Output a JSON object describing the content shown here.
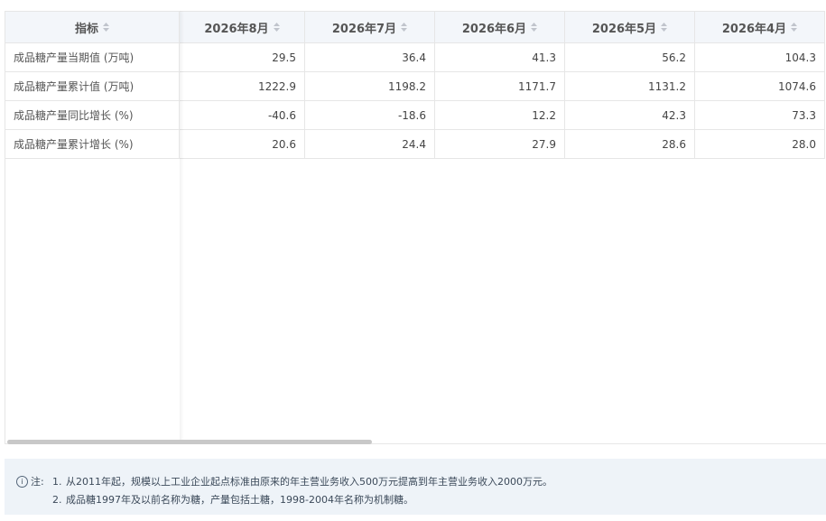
{
  "table": {
    "index_header": "指标",
    "columns": [
      "2026年8月",
      "2026年7月",
      "2026年6月",
      "2026年5月",
      "2026年4月"
    ],
    "rows": [
      {
        "label": "成品糖产量当期值 (万吨)",
        "values": [
          "29.5",
          "36.4",
          "41.3",
          "56.2",
          "104.3"
        ]
      },
      {
        "label": "成品糖产量累计值 (万吨)",
        "values": [
          "1222.9",
          "1198.2",
          "1171.7",
          "1131.2",
          "1074.6"
        ]
      },
      {
        "label": "成品糖产量同比增长 (%)",
        "values": [
          "-40.6",
          "-18.6",
          "12.2",
          "42.3",
          "73.3"
        ]
      },
      {
        "label": "成品糖产量累计增长 (%)",
        "values": [
          "20.6",
          "24.4",
          "27.9",
          "28.6",
          "28.0"
        ]
      }
    ]
  },
  "notes": {
    "icon": "info-circle-icon",
    "prefix": "注:",
    "items": [
      {
        "num": "1.",
        "text": "从2011年起，规模以上工业企业起点标准由原来的年主营业务收入500万元提高到年主营业务收入2000万元。"
      },
      {
        "num": "2.",
        "text": "成品糖1997年及以前名称为糖，产量包括土糖，1998-2004年名称为机制糖。"
      }
    ]
  },
  "colors": {
    "header_bg": "#f3f6fa",
    "notes_bg": "#eef3f8",
    "border": "#e6e6e6"
  }
}
